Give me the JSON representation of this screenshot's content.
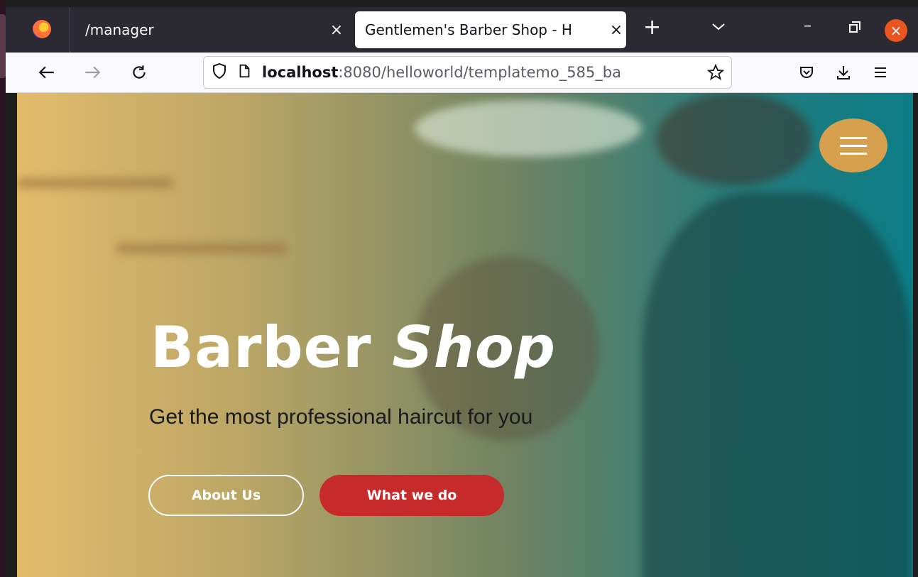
{
  "browser": {
    "tabs": [
      {
        "title": "/manager",
        "active": false
      },
      {
        "title": "Gentlemen's Barber Shop - H",
        "active": true
      }
    ],
    "new_tab_label": "+",
    "url_host": "localhost",
    "url_rest": ":8080/helloworld/templatemo_585_ba"
  },
  "hero": {
    "title_main": "Barber ",
    "title_em": "Shop",
    "subtitle": "Get the most professional haircut for you",
    "buttons": {
      "about": "About Us",
      "what": "What we do"
    }
  },
  "colors": {
    "accent_red": "#c62a2a",
    "menu_gold": "#d7a04f",
    "gradient_left": "#eec46e",
    "gradient_right": "#0a828c"
  }
}
